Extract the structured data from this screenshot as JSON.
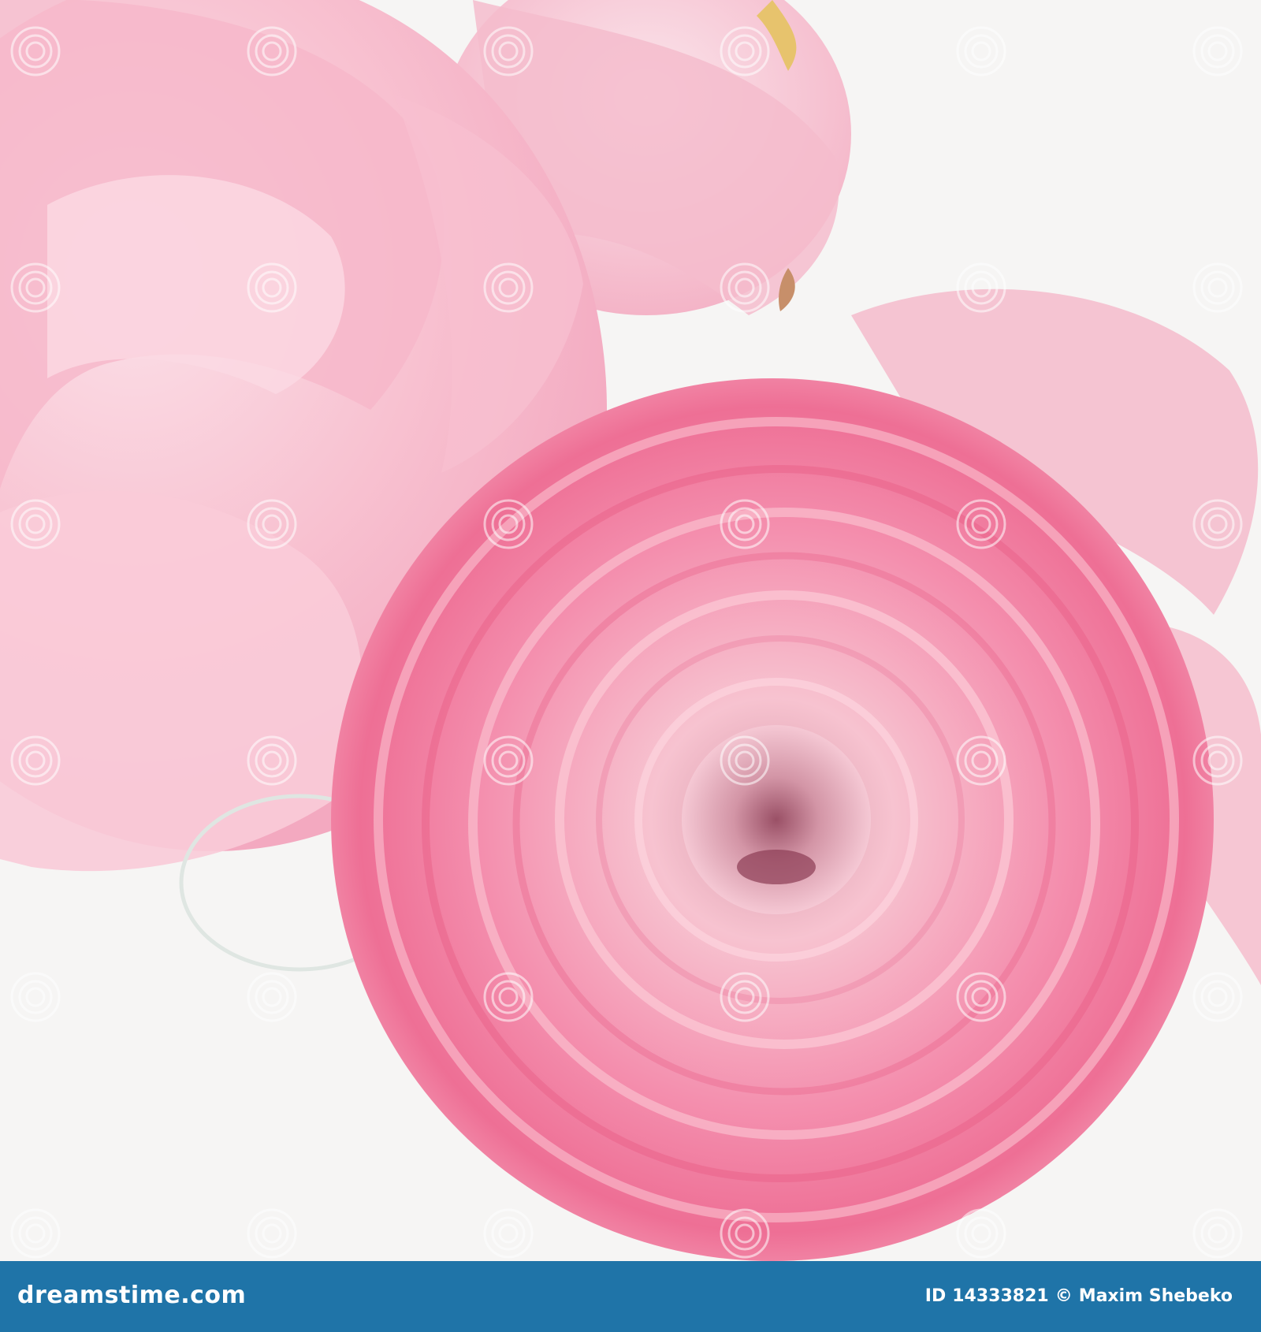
{
  "photo": {
    "subject": "pink ranunculus flowers",
    "colors": {
      "background": "#f6f5f4",
      "petal_light": "#f7c6d3",
      "petal_mid": "#f48fae",
      "petal_deep": "#ec5b86",
      "center": "#c98a9c"
    },
    "watermark_text": "dreamstime"
  },
  "footer": {
    "background": "#1f74a8",
    "site": "dreamstime.com",
    "id_label": "ID",
    "id_number": "14333821",
    "copyright": "©",
    "author": "Maxim Shebeko"
  }
}
